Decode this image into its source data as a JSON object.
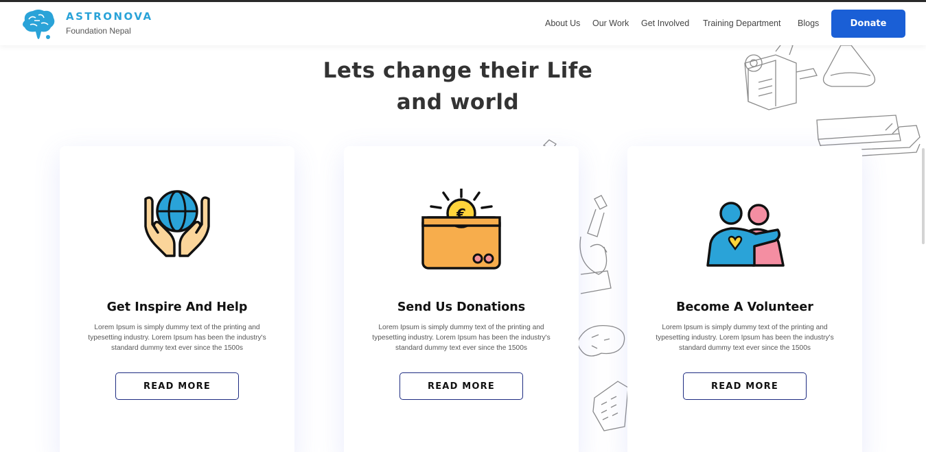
{
  "header": {
    "brand_name": "ASTRONOVA",
    "brand_sub": "Foundation Nepal",
    "logo_icon": "brain-logo-icon",
    "nav": [
      {
        "label": "About Us"
      },
      {
        "label": "Our Work"
      },
      {
        "label": "Get Involved"
      },
      {
        "label": "Training Department"
      },
      {
        "label": "Blogs"
      }
    ],
    "donate_label": "Donate"
  },
  "hero": {
    "title_line1": "Lets change their Life",
    "title_line2": "and world"
  },
  "cards": [
    {
      "icon": "globe-in-hands-icon",
      "title": "Get Inspire And Help",
      "text": "Lorem Ipsum is simply dummy text of the printing and typesetting industry. Lorem Ipsum has been the industry's standard dummy text ever since the 1500s",
      "button": "READ MORE"
    },
    {
      "icon": "donation-wallet-icon",
      "title": "Send Us Donations",
      "text": "Lorem Ipsum is simply dummy text of the printing and typesetting industry. Lorem Ipsum has been the industry's standard dummy text ever since the 1500s",
      "button": "READ MORE"
    },
    {
      "icon": "volunteer-people-icon",
      "title": "Become A Volunteer",
      "text": "Lorem Ipsum is simply dummy text of the printing and typesetting industry. Lorem Ipsum has been the industry's standard dummy text ever since the 1500s",
      "button": "READ MORE"
    }
  ],
  "colors": {
    "brand": "#2aa3d8",
    "donate_bg": "#1a5fd6",
    "button_border": "#1c2a80"
  }
}
